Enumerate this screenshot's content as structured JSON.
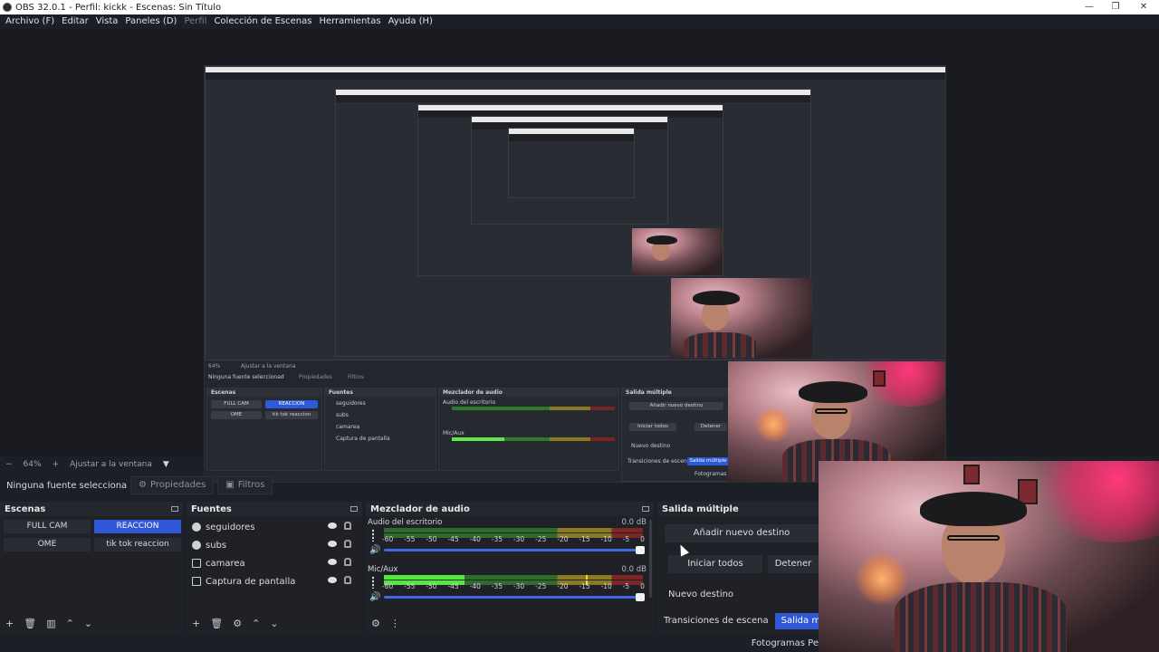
{
  "window": {
    "title": "OBS 32.0.1 - Perfil: kickk - Escenas: Sin Título",
    "minimize": "—",
    "maximize": "❐",
    "close": "✕"
  },
  "menu": [
    {
      "label": "Archivo (F)"
    },
    {
      "label": "Editar"
    },
    {
      "label": "Vista"
    },
    {
      "label": "Paneles (D)"
    },
    {
      "label": "Perfil"
    },
    {
      "label": "Colección de Escenas"
    },
    {
      "label": "Herramientas"
    },
    {
      "label": "Ayuda (H)"
    }
  ],
  "zoom": {
    "minus": "−",
    "level": "64%",
    "plus": "+",
    "fit": "Ajustar a la ventana",
    "dropdown": "▼"
  },
  "properties_bar": {
    "no_source": "Ninguna fuente seleccionada",
    "properties": "Propiedades",
    "filters": "Filtros"
  },
  "scenes": {
    "title": "Escenas",
    "items": [
      {
        "label": "FULL CAM",
        "active": false
      },
      {
        "label": "REACCION",
        "active": true
      },
      {
        "label": "OME",
        "active": false
      },
      {
        "label": "tik tok reaccion",
        "active": false
      }
    ],
    "footer": [
      "+",
      "🗑",
      "▥",
      "⌃",
      "⌄"
    ]
  },
  "sources": {
    "title": "Fuentes",
    "items": [
      {
        "label": "seguidores",
        "icon": "globe"
      },
      {
        "label": "subs",
        "icon": "globe"
      },
      {
        "label": "camarea",
        "icon": "camera"
      },
      {
        "label": "Captura de pantalla",
        "icon": "monitor"
      }
    ],
    "footer": [
      "+",
      "🗑",
      "⚙",
      "⌃",
      "⌄"
    ]
  },
  "mixer": {
    "title": "Mezclador de audio",
    "channels": [
      {
        "name": "Audio del escritorio",
        "db": "0.0 dB",
        "level": 0,
        "peak": 0
      },
      {
        "name": "Mic/Aux",
        "db": "0.0 dB",
        "level": 0.31,
        "peak": 0.78
      }
    ],
    "ticks": [
      "-60",
      "-55",
      "-50",
      "-45",
      "-40",
      "-35",
      "-30",
      "-25",
      "-20",
      "-15",
      "-10",
      "-5",
      "0"
    ],
    "volume_icon": "🔊",
    "footer": [
      "⚙",
      "⋮"
    ]
  },
  "multi_output": {
    "title": "Salida múltiple",
    "add": "Añadir nuevo destino",
    "start_all": "Iniciar todos",
    "stop": "Detener",
    "new_target": "Nuevo destino"
  },
  "bottom_tabs": [
    {
      "label": "Transiciones de escena",
      "active": false
    },
    {
      "label": "Salida múltiple",
      "active": true
    }
  ],
  "status": {
    "fps": "Fotogramas Pe"
  },
  "preview_nested": {
    "no_source": "Ninguna fuente seleccionad",
    "properties": "Propiedades",
    "filters": "Filtros",
    "scenes_title": "Escenas",
    "sources_title": "Fuentes",
    "mixer_title": "Mezclador de audio",
    "multi_title": "Salida múltiple",
    "scenes": [
      "FULL CAM",
      "REACCION",
      "OME",
      "tik tok reaccion"
    ],
    "sources": [
      "seguidores",
      "subs",
      "camarea",
      "Captura de pantalla"
    ],
    "ch1": "Audio del escritorio",
    "ch2": "Mic/Aux",
    "add": "Añadir nuevo destino",
    "start": "Iniciar todos",
    "stop": "Detener",
    "new_target": "Nuevo destino",
    "transitions": "Transiciones de escena",
    "multi_tab": "Salida múltiple",
    "fps": "Fotogramas Pe",
    "zoom": "64%",
    "fit": "Ajustar a la ventana"
  },
  "colors": {
    "accent": "#2f57d6",
    "meter_green": "#53e83e",
    "background": "#1d1f26"
  }
}
